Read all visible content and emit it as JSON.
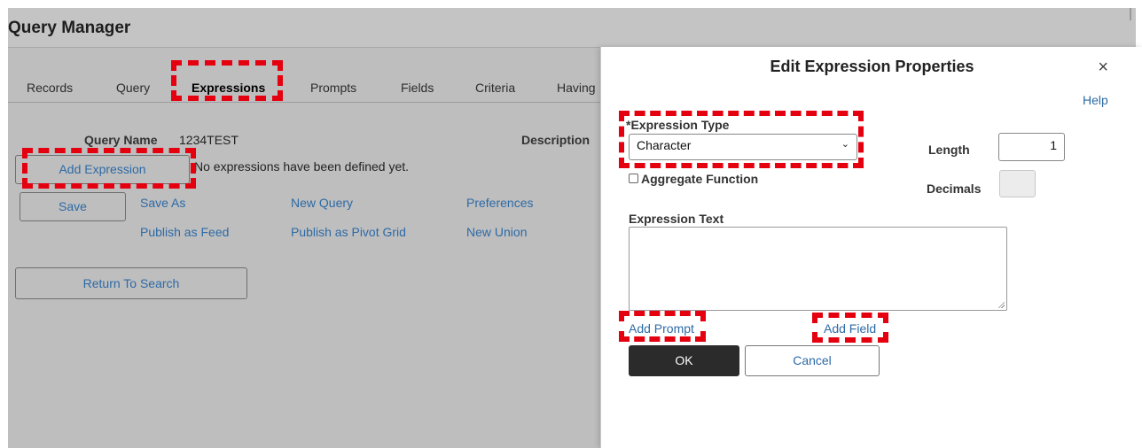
{
  "app": {
    "title": "Query Manager"
  },
  "tabs": [
    {
      "label": "Records"
    },
    {
      "label": "Query"
    },
    {
      "label": "Expressions"
    },
    {
      "label": "Prompts"
    },
    {
      "label": "Fields"
    },
    {
      "label": "Criteria"
    },
    {
      "label": "Having"
    }
  ],
  "main": {
    "query_name_label": "Query Name",
    "query_name_value": "1234TEST",
    "description_label": "Description",
    "add_expression_label": "Add Expression",
    "empty_message": "No expressions have been defined yet.",
    "save_label": "Save",
    "links": {
      "save_as": "Save As",
      "new_query": "New Query",
      "preferences": "Preferences",
      "publish_feed": "Publish as Feed",
      "publish_pivot": "Publish as Pivot Grid",
      "new_union": "New Union"
    },
    "return_label": "Return To Search"
  },
  "dialog": {
    "title": "Edit Expression Properties",
    "close_glyph": "×",
    "help_label": "Help",
    "expression_type_label": "*Expression Type",
    "expression_type_value": "Character",
    "chevron_glyph": "⌄",
    "length_label": "Length",
    "length_value": "1",
    "aggregate_label": "Aggregate Function",
    "aggregate_checked": false,
    "decimals_label": "Decimals",
    "decimals_value": "",
    "expression_text_label": "Expression Text",
    "expression_text_value": "",
    "add_prompt_label": "Add Prompt",
    "add_field_label": "Add Field",
    "ok_label": "OK",
    "cancel_label": "Cancel"
  },
  "colors": {
    "highlight": "#e4000f",
    "link": "#2d6aa6",
    "ok_bg": "#2b2b2b",
    "app_bg": "#bebebe"
  }
}
